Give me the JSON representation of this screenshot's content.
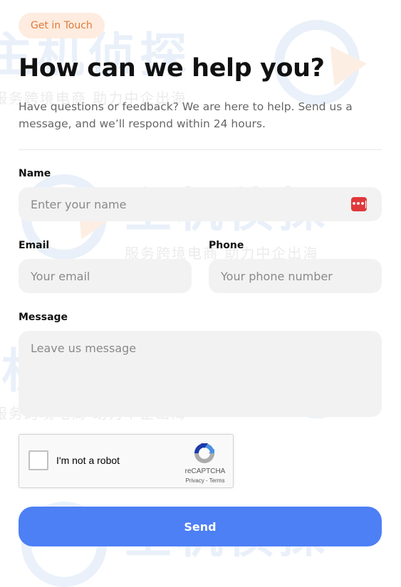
{
  "header": {
    "badge": "Get in Touch",
    "title": "How can we help you?",
    "subtitle": "Have questions or feedback? We are here to help. Send us a message, and we’ll respond within 24 hours."
  },
  "form": {
    "name": {
      "label": "Name",
      "placeholder": "Enter your name",
      "value": ""
    },
    "email": {
      "label": "Email",
      "placeholder": "Your email",
      "value": ""
    },
    "phone": {
      "label": "Phone",
      "placeholder": "Your phone number",
      "value": ""
    },
    "message": {
      "label": "Message",
      "placeholder": "Leave us message",
      "value": ""
    },
    "submit_label": "Send"
  },
  "recaptcha": {
    "label": "I'm not a robot",
    "brand": "reCAPTCHA",
    "privacy": "Privacy",
    "separator": " - ",
    "terms": "Terms"
  },
  "watermark": {
    "brand": "主机侦探",
    "slogan": "服务跨境电商 助力中企出海"
  },
  "colors": {
    "accent": "#4d7ff5",
    "badge_bg": "#fdecdf",
    "badge_text": "#e07a3c",
    "field_bg": "#f2f2f2",
    "password_manager_icon": "#e0383b"
  }
}
